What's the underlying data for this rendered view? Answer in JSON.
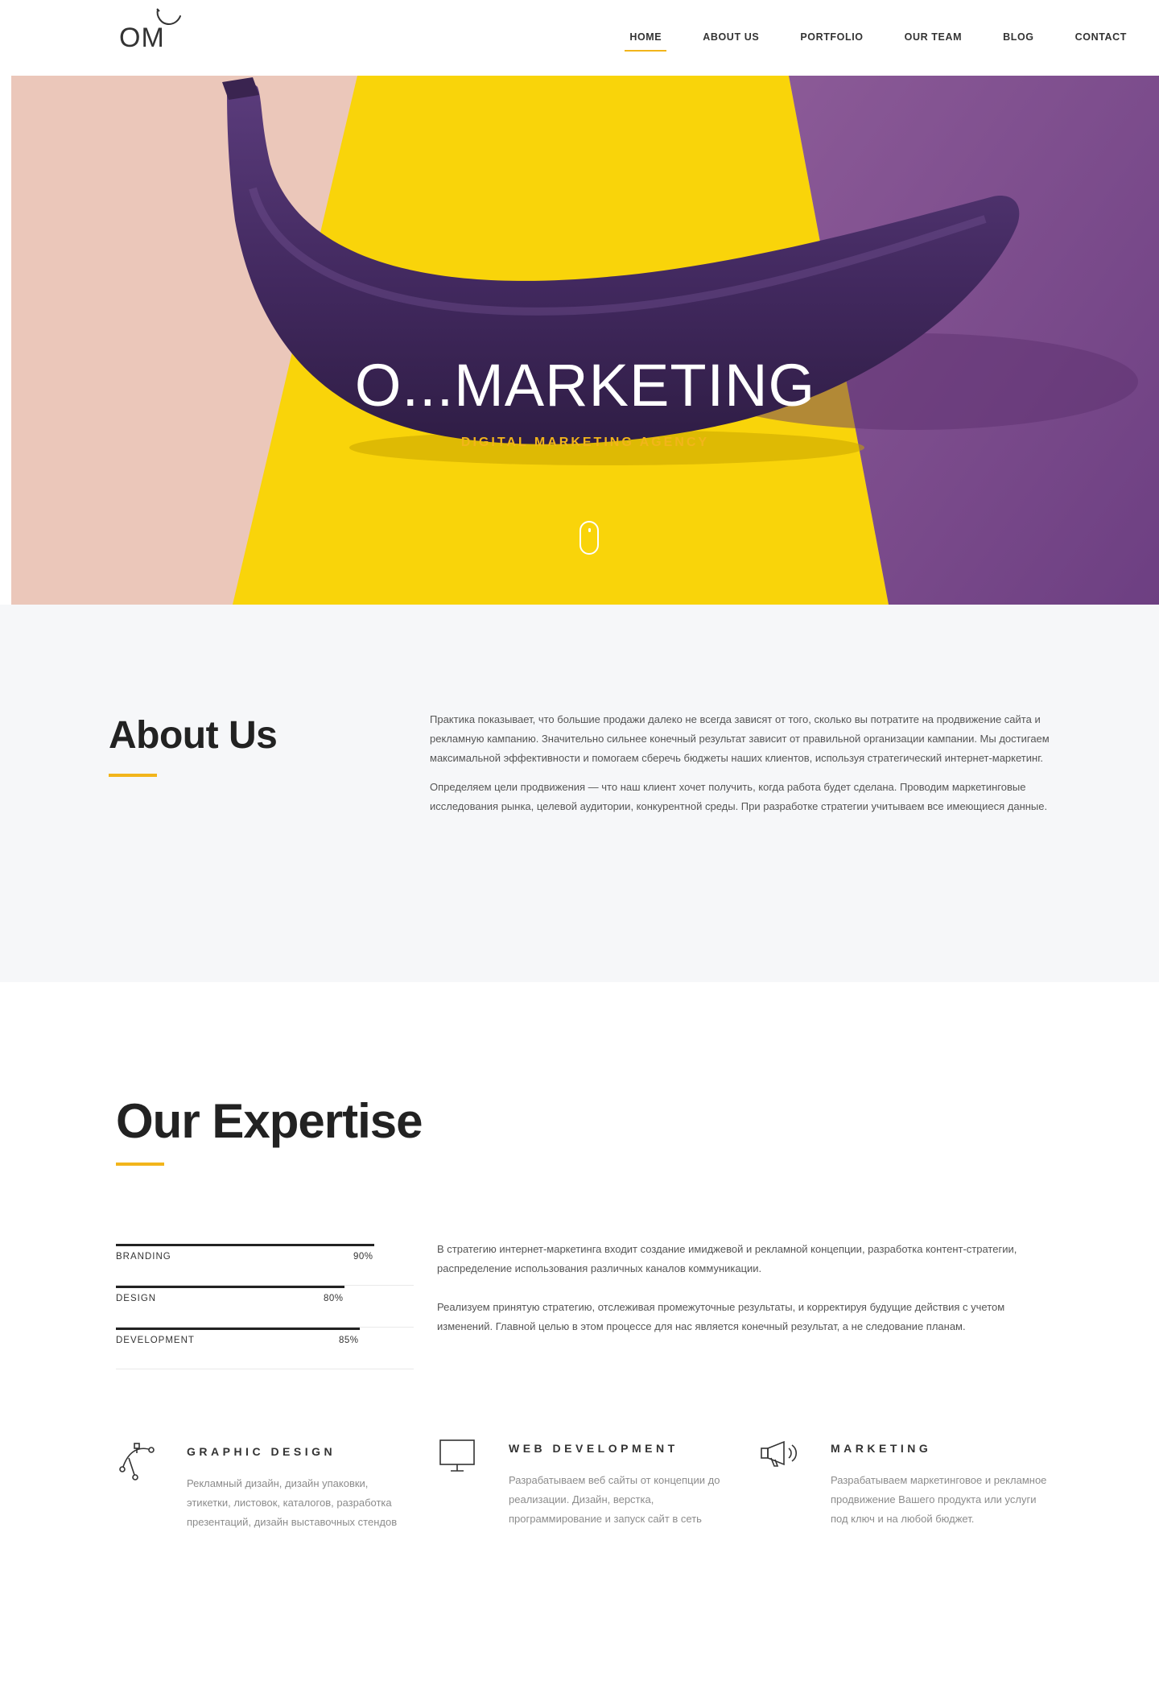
{
  "header": {
    "logo_text": "OM",
    "nav": [
      "HOME",
      "ABOUT US",
      "PORTFOLIO",
      "OUR TEAM",
      "BLOG",
      "CONTACT"
    ],
    "active_nav": "HOME"
  },
  "hero": {
    "title": "O...MARKETING",
    "subtitle": "DIGITAL MARKETING AGENCY",
    "scroll_icon": "mouse-scroll-icon"
  },
  "about": {
    "title": "About Us",
    "paragraphs": [
      "Практика показывает, что большие продажи далеко не всегда зависят от того, сколько вы потратите на продвижение сайта и рекламную кампанию. Значительно сильнее конечный результат зависит от правильной организации кампании. Мы достигаем максимальной эффективности и помогаем сберечь бюджеты наших клиентов, используя стратегический интернет-маркетинг.",
      "Определяем цели продвижения — что наш клиент хочет получить, когда работа будет сделана. Проводим маркетинговые исследования рынка, целевой аудитории, конкурентной среды. При разработке стратегии учитываем все имеющиеся данные."
    ]
  },
  "expertise": {
    "title": "Our Expertise",
    "skills": [
      {
        "label": "BRANDING",
        "value": "90%",
        "percent": 90
      },
      {
        "label": "DESIGN",
        "value": "80%",
        "percent": 80
      },
      {
        "label": "DEVELOPMENT",
        "value": "85%",
        "percent": 85
      }
    ],
    "paragraphs": [
      "В стратегию интернет-маркетинга входит создание имиджевой и рекламной концепции, разработка контент-стратегии, распределение использования различных каналов коммуникации.",
      "Реализуем принятую стратегию, отслеживая промежуточные результаты, и корректируя будущие действия с учетом изменений. Главной целью в этом процессе для нас является конечный результат, а не следование планам."
    ]
  },
  "services": [
    {
      "icon": "bezier-pen-icon",
      "title": "GRAPHIC DESIGN",
      "desc": "Рекламный дизайн, дизайн упаковки, этикетки, листовок, каталогов, разработка презентаций, дизайн выставочных стендов"
    },
    {
      "icon": "monitor-icon",
      "title": "WEB DEVELOPMENT",
      "desc": "Разрабатываем веб сайты от концепции до реализации. Дизайн, верстка, программирование и запуск сайт в сеть"
    },
    {
      "icon": "megaphone-icon",
      "title": "MARKETING",
      "desc": "Разрабатываем маркетинговое и рекламное продвижение Вашего продукта или услуги под ключ и на любой бюджет."
    }
  ],
  "colors": {
    "accent": "#f2b51b",
    "hero_pink": "#e9c7bb",
    "hero_yellow": "#f9d40a",
    "hero_purple": "#7e4b8f",
    "banana": "#4a2f6a"
  }
}
